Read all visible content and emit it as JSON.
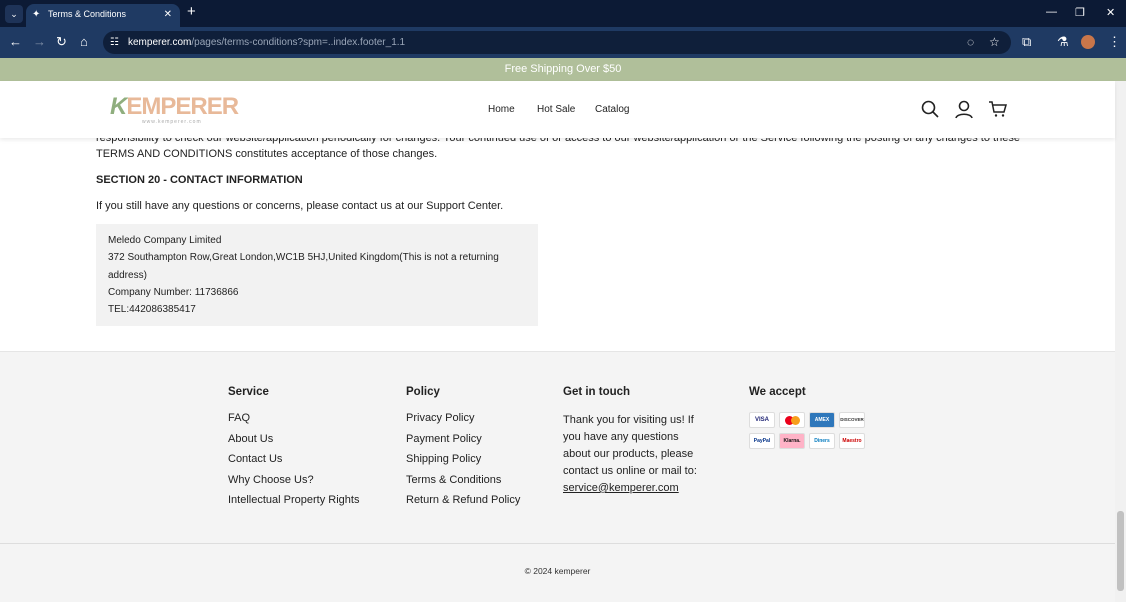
{
  "browser": {
    "tab_title": "Terms & Conditions",
    "url_host": "kemperer.com",
    "url_path": "/pages/terms-conditions?spm=..index.footer_1.1"
  },
  "banner": "Free Shipping Over $50",
  "header": {
    "logo": "EMPERER",
    "logo_k": "K",
    "logo_sub": "www.kemperer.com",
    "nav": [
      "Home",
      "Hot Sale",
      "Catalog"
    ]
  },
  "content": {
    "para_line1": "responsibility to check our website/application periodically for changes. Your continued use of or access to our website/application or the Service following the posting of any changes to these",
    "para_line2": "TERMS AND CONDITIONS constitutes acceptance of those changes.",
    "section_title": "SECTION 20 - CONTACT INFORMATION",
    "contact_text": "If you still have any questions or concerns, please contact us at our Support Center.",
    "address": [
      "Meledo Company Limited",
      "372 Southampton Row,Great London,WC1B 5HJ,United Kingdom(This is not a returning address)",
      "Company Number:  11736866",
      "TEL:442086385417"
    ]
  },
  "footer": {
    "service": {
      "title": "Service",
      "links": [
        "FAQ",
        "About Us",
        "Contact Us",
        "Why Choose Us?",
        "Intellectual Property Rights"
      ]
    },
    "policy": {
      "title": "Policy",
      "links": [
        "Privacy Policy",
        "Payment Policy",
        "Shipping Policy",
        "Terms & Conditions",
        "Return & Refund Policy"
      ]
    },
    "touch": {
      "title": "Get in touch",
      "text": "Thank you for visiting us! If you have any questions about our products, please contact us online or mail to: ",
      "email": "service@kemperer.com"
    },
    "accept": {
      "title": "We accept",
      "cards": [
        "VISA",
        "MC",
        "AMEX",
        "DISCOVER",
        "PayPal",
        "Klarna.",
        "Diners",
        "Maestro"
      ]
    },
    "copyright": "© 2024 kemperer"
  }
}
